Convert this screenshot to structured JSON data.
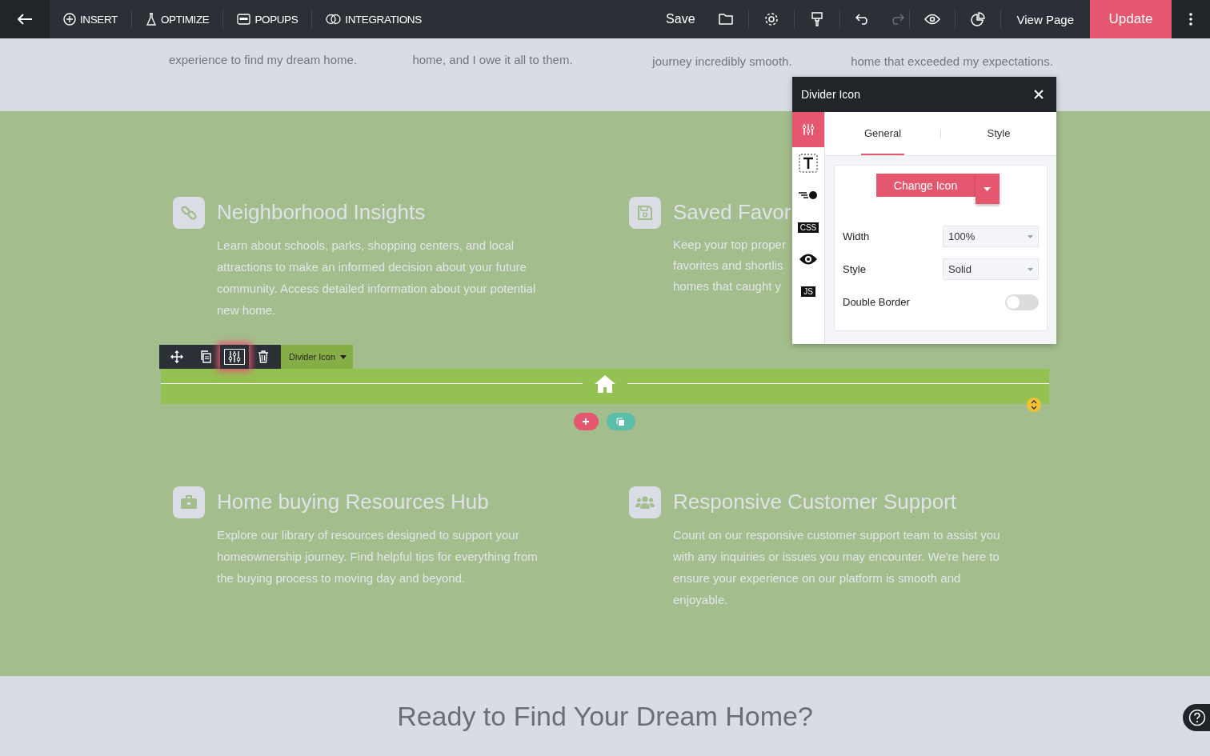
{
  "topbar": {
    "menu": [
      {
        "kind": "insert",
        "label": "INSERT"
      },
      {
        "kind": "optimize",
        "label": "OPTIMIZE"
      },
      {
        "kind": "popups",
        "label": "POPUPS"
      },
      {
        "kind": "integrations",
        "label": "INTEGRATIONS"
      }
    ],
    "save": "Save",
    "tools": [
      {
        "kind": "folder",
        "disabled": false
      },
      {
        "kind": "gear",
        "disabled": false
      },
      {
        "kind": "brush",
        "disabled": false
      },
      {
        "kind": "undo",
        "disabled": false
      },
      {
        "kind": "redo",
        "disabled": true
      },
      {
        "kind": "eye",
        "disabled": false
      },
      {
        "kind": "pie",
        "disabled": false
      }
    ],
    "view_page": "View Page",
    "update": "Update"
  },
  "testimonials": [
    "experience to find my dream home.",
    "home, and I owe it all to them.",
    "journey incredibly smooth.",
    "home that exceeded my expectations."
  ],
  "features_top": [
    {
      "kind": "link",
      "title": "Neighborhood Insights",
      "lines": [
        "Learn about schools, parks, shopping centers, and local attractions to make an informed decision about your future community. Access detailed information about your potential new home."
      ]
    },
    {
      "kind": "save",
      "title": "Saved Favor",
      "lines": [
        "Keep your top proper",
        "favorites and shortlis",
        "homes that caught y"
      ]
    }
  ],
  "element_toolbar": {
    "buttons": [
      {
        "kind": "move",
        "selected": false
      },
      {
        "kind": "copy",
        "selected": false
      },
      {
        "kind": "settings",
        "selected": true
      },
      {
        "kind": "delete",
        "selected": false
      }
    ],
    "label": "Divider Icon"
  },
  "features_bottom": [
    {
      "kind": "briefcase",
      "title": "Home buying Resources Hub",
      "lines": [
        "Explore our library of resources designed to support your homeownership journey. Find helpful tips for everything from the buying process to moving day and beyond."
      ]
    },
    {
      "kind": "users",
      "title": "Responsive Customer Support",
      "lines": [
        "Count on our responsive customer support team to assist you with any inquiries or issues you may encounter. We're here to ensure your experience on our platform is smooth and enjoyable."
      ]
    }
  ],
  "cta_heading": "Ready to Find Your Dream Home?",
  "panel": {
    "title": "Divider Icon",
    "side_tabs": [
      {
        "kind": "sliders",
        "selected": true
      },
      {
        "kind": "text",
        "selected": false
      },
      {
        "kind": "motion",
        "selected": false
      },
      {
        "kind": "code",
        "label": "CSS",
        "selected": false
      },
      {
        "kind": "eye",
        "selected": false
      },
      {
        "kind": "code",
        "label": "JS",
        "selected": false
      }
    ],
    "tabs": [
      {
        "label": "General",
        "selected": true
      },
      {
        "label": "Style",
        "selected": false
      }
    ],
    "change_icon": "Change Icon",
    "fields": [
      {
        "kind": "select",
        "label": "Width",
        "value": "100%"
      },
      {
        "kind": "select",
        "label": "Style",
        "value": "Solid"
      },
      {
        "kind": "toggle",
        "label": "Double Border",
        "on": false
      }
    ]
  }
}
